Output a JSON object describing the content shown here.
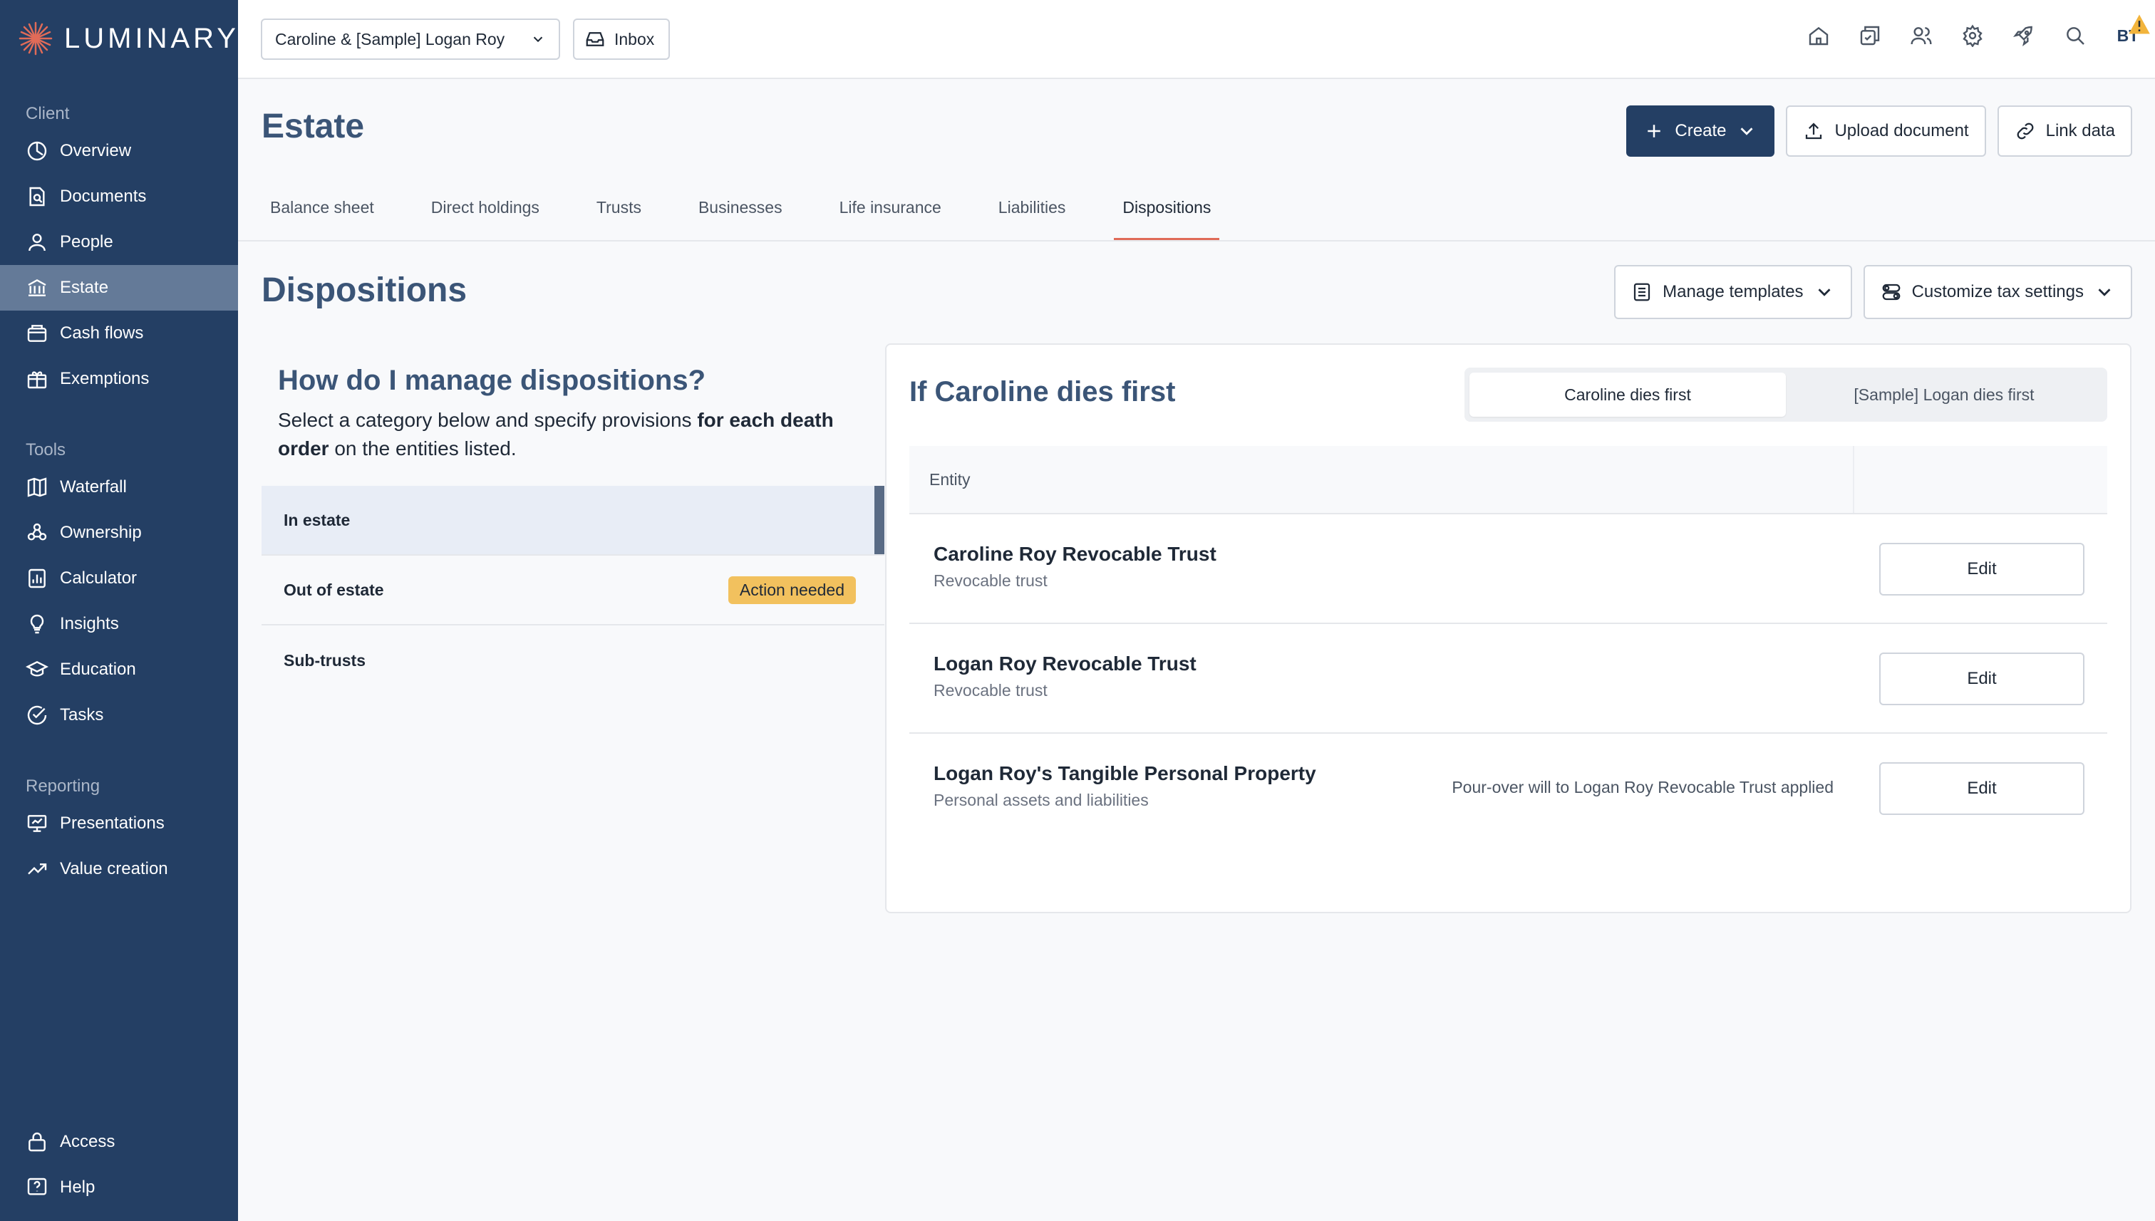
{
  "brand": {
    "logo_text": "LUMINARY",
    "accent": "#e06b58",
    "sidebar_bg": "#243f64"
  },
  "sidebar": {
    "sections": [
      {
        "header": "Client",
        "items": [
          {
            "label": "Overview",
            "icon": "overview-icon"
          },
          {
            "label": "Documents",
            "icon": "documents-icon"
          },
          {
            "label": "People",
            "icon": "people-icon"
          },
          {
            "label": "Estate",
            "icon": "estate-icon",
            "active": true
          },
          {
            "label": "Cash flows",
            "icon": "cash-flows-icon"
          },
          {
            "label": "Exemptions",
            "icon": "exemptions-icon"
          }
        ]
      },
      {
        "header": "Tools",
        "items": [
          {
            "label": "Waterfall",
            "icon": "waterfall-icon"
          },
          {
            "label": "Ownership",
            "icon": "ownership-icon"
          },
          {
            "label": "Calculator",
            "icon": "calculator-icon"
          },
          {
            "label": "Insights",
            "icon": "insights-icon"
          },
          {
            "label": "Education",
            "icon": "education-icon"
          },
          {
            "label": "Tasks",
            "icon": "tasks-icon"
          }
        ]
      },
      {
        "header": "Reporting",
        "items": [
          {
            "label": "Presentations",
            "icon": "presentations-icon"
          },
          {
            "label": "Value creation",
            "icon": "value-creation-icon"
          }
        ]
      }
    ],
    "footer": [
      {
        "label": "Access",
        "icon": "lock-icon"
      },
      {
        "label": "Help",
        "icon": "help-icon"
      }
    ]
  },
  "topbar": {
    "client_select": "Caroline & [Sample] Logan Roy",
    "inbox": "Inbox",
    "icons": [
      "home-icon",
      "messages-icon",
      "users-icon",
      "gear-icon",
      "rocket-icon",
      "search-icon"
    ],
    "avatar": "BT"
  },
  "page": {
    "title": "Estate",
    "actions": {
      "create": "Create",
      "upload": "Upload document",
      "link": "Link data"
    },
    "tabs": [
      "Balance sheet",
      "Direct holdings",
      "Trusts",
      "Businesses",
      "Life insurance",
      "Liabilities",
      "Dispositions"
    ],
    "active_tab": "Dispositions"
  },
  "section": {
    "title": "Dispositions",
    "manage_templates": "Manage templates",
    "customize_tax": "Customize tax settings"
  },
  "help": {
    "title": "How do I manage dispositions?",
    "text_before": "Select a category below and specify provisions ",
    "text_bold": "for each death order",
    "text_after": " on the entities listed."
  },
  "categories": [
    {
      "label": "In estate",
      "active": true
    },
    {
      "label": "Out of estate",
      "badge": "Action needed"
    },
    {
      "label": "Sub-trusts"
    }
  ],
  "dispositions": {
    "title": "If Caroline dies first",
    "toggle": [
      "Caroline dies first",
      "[Sample] Logan dies first"
    ],
    "column_header": "Entity",
    "edit_label": "Edit",
    "rows": [
      {
        "name": "Caroline Roy Revocable Trust",
        "type": "Revocable trust",
        "note": ""
      },
      {
        "name": "Logan Roy Revocable Trust",
        "type": "Revocable trust",
        "note": ""
      },
      {
        "name": "Logan Roy's Tangible Personal Property",
        "type": "Personal assets and liabilities",
        "note": "Pour-over will to Logan Roy Revocable Trust applied"
      }
    ]
  }
}
